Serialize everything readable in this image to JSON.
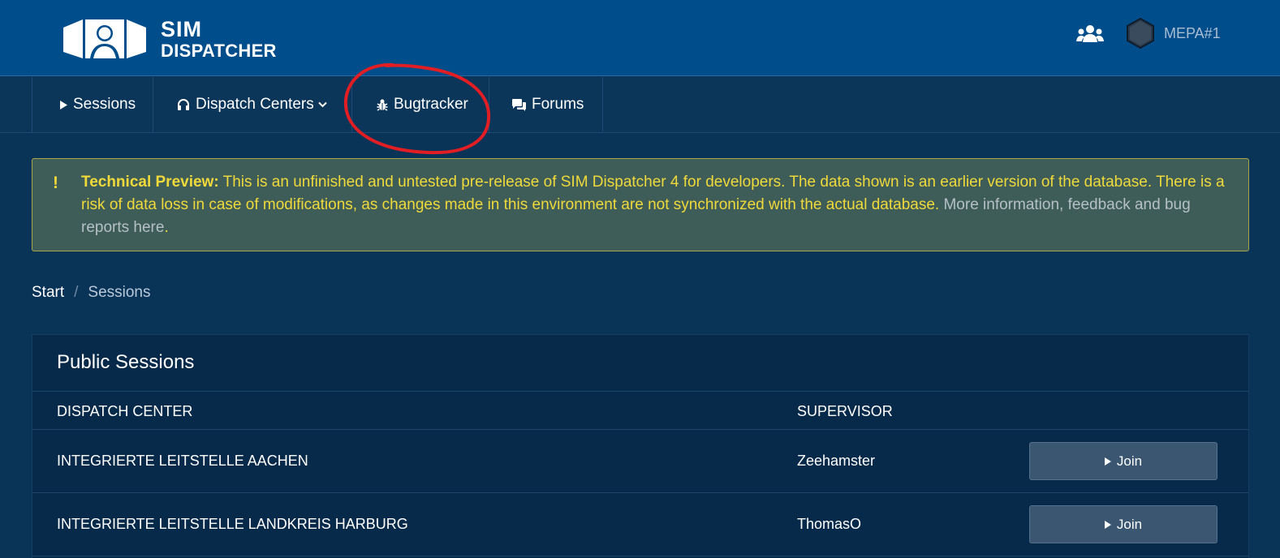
{
  "header": {
    "logo_line1": "SIM",
    "logo_line2": "DISPATCHER",
    "user_name": "MEPA#1"
  },
  "nav": {
    "items": [
      {
        "label": "Sessions",
        "icon": "play-icon"
      },
      {
        "label": "Dispatch Centers",
        "icon": "headset-icon"
      },
      {
        "label": "Bugtracker",
        "icon": "bug-icon"
      },
      {
        "label": "Forums",
        "icon": "comments-icon"
      }
    ]
  },
  "alert": {
    "title": "Technical Preview:",
    "body": " This is an unfinished and untested pre-release of SIM Dispatcher 4 for developers. The data shown is an earlier version of the database. There is a risk of data loss in case of modifications, as changes made in this environment are not synchronized with the actual database. ",
    "link": "More information, feedback and bug reports here",
    "end": "."
  },
  "breadcrumb": {
    "start": "Start",
    "separator": "/",
    "current": "Sessions"
  },
  "sessions": {
    "title": "Public Sessions",
    "columns": [
      "DISPATCH CENTER",
      "SUPERVISOR"
    ],
    "rows": [
      {
        "center": "INTEGRIERTE LEITSTELLE AACHEN",
        "supervisor": "Zeehamster",
        "action": "Join"
      },
      {
        "center": "INTEGRIERTE LEITSTELLE LANDKREIS HARBURG",
        "supervisor": "ThomasO",
        "action": "Join"
      }
    ]
  },
  "colors": {
    "header_bg": "#004d8c",
    "page_bg": "#0a3358",
    "alert_text": "#f0d93a",
    "annotation": "#e01e24"
  }
}
